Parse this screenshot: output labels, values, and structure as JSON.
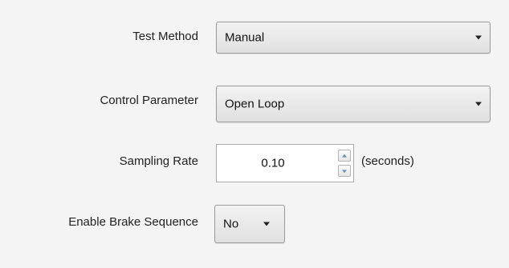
{
  "form": {
    "test_method": {
      "label": "Test Method",
      "value": "Manual"
    },
    "control_parameter": {
      "label": "Control Parameter",
      "value": "Open Loop"
    },
    "sampling_rate": {
      "label": "Sampling Rate",
      "value": "0.10",
      "units": "(seconds)"
    },
    "enable_brake_sequence": {
      "label": "Enable Brake Sequence",
      "value": "No"
    }
  },
  "icons": {
    "dropdown_arrow": "chevron-down-icon",
    "spin_up": "arrow-up-icon",
    "spin_down": "arrow-down-icon"
  },
  "colors": {
    "background": "#f4f4f4",
    "dropdown_border": "#9a9a9a",
    "spin_arrow": "#6a8fb5"
  }
}
